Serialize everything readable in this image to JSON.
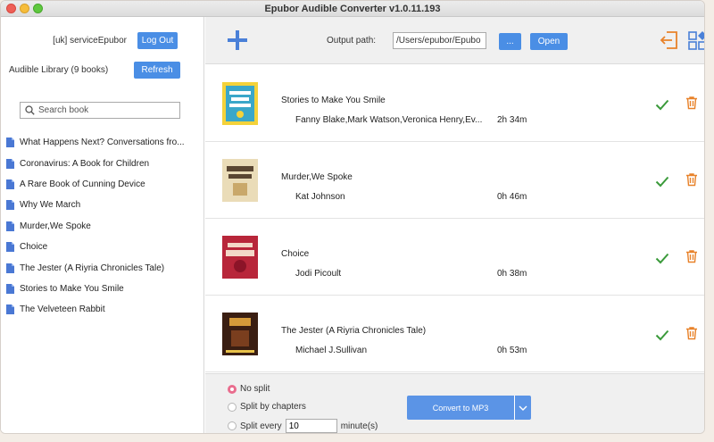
{
  "window": {
    "title": "Epubor Audible Converter v1.0.11.193"
  },
  "account": {
    "name": "[uk] serviceEpubor",
    "logout_label": "Log Out"
  },
  "library": {
    "label": "Audible Library (9 books)",
    "refresh_label": "Refresh"
  },
  "search": {
    "placeholder": "Search book"
  },
  "books": [
    "What Happens Next? Conversations fro...",
    "Coronavirus: A Book for Children",
    "A Rare Book of Cunning Device",
    "Why We March",
    "Murder,We Spoke",
    "Choice",
    "The Jester (A Riyria Chronicles Tale)",
    "Stories to Make You Smile",
    "The Velveteen Rabbit"
  ],
  "toolbar": {
    "output_label": "Output path:",
    "output_path": "/Users/epubor/Epubo",
    "browse_label": "...",
    "open_label": "Open",
    "icons": [
      "add-icon",
      "logout-icon",
      "layout-icon"
    ]
  },
  "queue": [
    {
      "title": "Stories to Make You Smile",
      "author": "Fanny Blake,Mark Watson,Veronica Henry,Ev...",
      "duration": "2h 34m"
    },
    {
      "title": "Murder,We Spoke",
      "author": "Kat Johnson",
      "duration": "0h 46m"
    },
    {
      "title": "Choice",
      "author": "Jodi Picoult",
      "duration": "0h 38m"
    },
    {
      "title": "The Jester (A Riyria Chronicles Tale)",
      "author": "Michael J.Sullivan",
      "duration": "0h 53m"
    }
  ],
  "footer": {
    "no_split_label": "No split",
    "split_chapters_label": "Split by chapters",
    "split_every_label": "Split every",
    "split_every_value": "10",
    "minutes_label": "minute(s)",
    "convert_label": "Convert to MP3"
  },
  "colors": {
    "accent": "#4a8ee5",
    "check": "#3a9a3a",
    "trash": "#e8822a",
    "radio_on": "#e96d8e"
  }
}
